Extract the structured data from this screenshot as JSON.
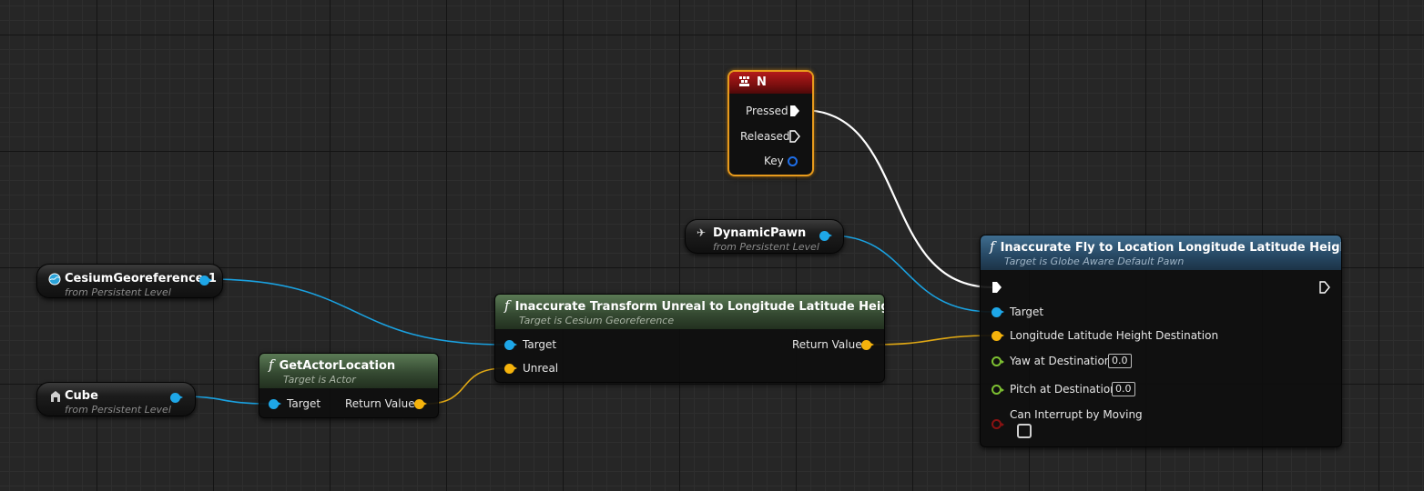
{
  "event_node": {
    "title": "N",
    "pins": [
      "Pressed",
      "Released",
      "Key"
    ]
  },
  "var_dynamic_pawn": {
    "name": "DynamicPawn",
    "sub": "from Persistent Level"
  },
  "var_cesium": {
    "name": "CesiumGeoreference-1",
    "sub": "from Persistent Level"
  },
  "var_cube": {
    "name": "Cube",
    "sub": "from Persistent Level"
  },
  "get_actor_location": {
    "title": "GetActorLocation",
    "sub": "Target is Actor",
    "input": "Target",
    "output": "Return Value"
  },
  "transform_node": {
    "title": "Inaccurate Transform Unreal to Longitude Latitude Height",
    "sub": "Target is Cesium Georeference",
    "inputs": [
      "Target",
      "Unreal"
    ],
    "output": "Return Value"
  },
  "fly_node": {
    "title": "Inaccurate Fly to Location Longitude Latitude Height",
    "sub": "Target is Globe Aware Default Pawn",
    "inputs": {
      "target": "Target",
      "destination": "Longitude Latitude Height Destination",
      "yaw": "Yaw at Destination",
      "yaw_value": "0.0",
      "pitch": "Pitch at Destination",
      "pitch_value": "0.0",
      "interrupt": "Can Interrupt by Moving"
    },
    "can_interrupt_checked": false
  },
  "function_glyph": "f",
  "colors": {
    "object_pin": "#1ea7e8",
    "vector_pin": "#f5b30c",
    "float_pin": "#7ec132",
    "bool_pin": "#8a1212",
    "exec_wire": "#ffffff",
    "event_border": "#e79a1c",
    "event_header": "#b31a1a"
  },
  "icons": {
    "event": "keyboard-key-icon",
    "dynamic_pawn": "pawn-icon",
    "cesium": "globe-icon",
    "cube": "static-mesh-icon",
    "function": "function-icon"
  }
}
